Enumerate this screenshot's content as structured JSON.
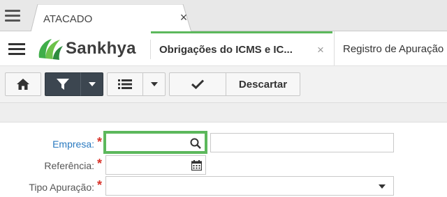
{
  "browser_tab": {
    "label": "ATACADO",
    "close": "×"
  },
  "brand": {
    "name": "Sankhya"
  },
  "app_tabs": [
    {
      "label": "Obrigações do ICMS e IC...",
      "close": "×",
      "active": true
    },
    {
      "label": "Registro de Apuração",
      "active": false
    }
  ],
  "toolbar": {
    "discard_label": "Descartar"
  },
  "form": {
    "empresa": {
      "label": "Empresa:",
      "required": "*",
      "value": "",
      "desc_value": ""
    },
    "referencia": {
      "label": "Referência:",
      "required": "*",
      "value": ""
    },
    "tipo_apuracao": {
      "label": "Tipo Apuração:",
      "required": "*",
      "value": ""
    }
  },
  "colors": {
    "accent_green": "#5cb85c",
    "label_blue": "#2a7ac0",
    "required_red": "#d9342b",
    "dark_button": "#3c4650"
  },
  "icons": [
    "menu-icon",
    "sankhya-logo-icon",
    "home-icon",
    "filter-icon",
    "chevron-down-icon",
    "list-icon",
    "check-icon",
    "search-icon",
    "calendar-icon"
  ]
}
